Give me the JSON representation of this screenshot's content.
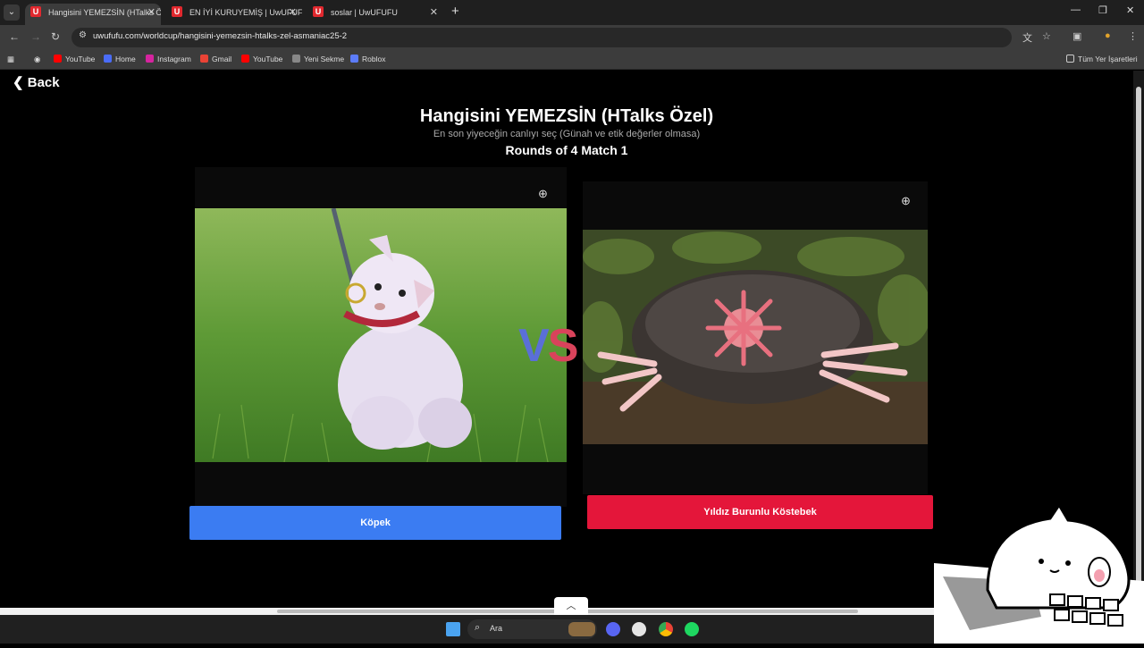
{
  "browser": {
    "tabs": [
      {
        "label": "Hangisini YEMEZSİN (HTalks Öz",
        "active": true
      },
      {
        "label": "EN İYİ KURUYEMİŞ | UwUFUFU",
        "active": false
      },
      {
        "label": "soslar | UwUFUFU",
        "active": false
      }
    ],
    "url": "uwufufu.com/worldcup/hangisini-yemezsin-htalks-zel-asmaniac25-2",
    "bookmarks": [
      "YouTube",
      "Home",
      "Instagram",
      "Gmail",
      "YouTube",
      "Yeni Sekme",
      "Roblox"
    ],
    "all_bookmarks_label": "Tüm Yer İşaretleri"
  },
  "page": {
    "back_label": "Back",
    "title": "Hangisini YEMEZSİN (HTalks Özel)",
    "subtitle": "En son yiyeceğin canlıyı seç (Günah ve etik değerler olmasa)",
    "round_info": "Rounds of 4 Match 1",
    "vs_left": "V",
    "vs_right": "S",
    "left_choice": {
      "label": "Köpek",
      "color": "#3b7cf2"
    },
    "right_choice": {
      "label": "Yıldız Burunlu Köstebek",
      "color": "#e4163a"
    }
  },
  "taskbar": {
    "search_label": "Ara"
  },
  "icons": [
    "search-icon",
    "zoom-in-icon",
    "back-chevron-icon",
    "windows-start-icon",
    "chrome-icon",
    "spotify-icon",
    "discord-icon",
    "obs-icon"
  ]
}
